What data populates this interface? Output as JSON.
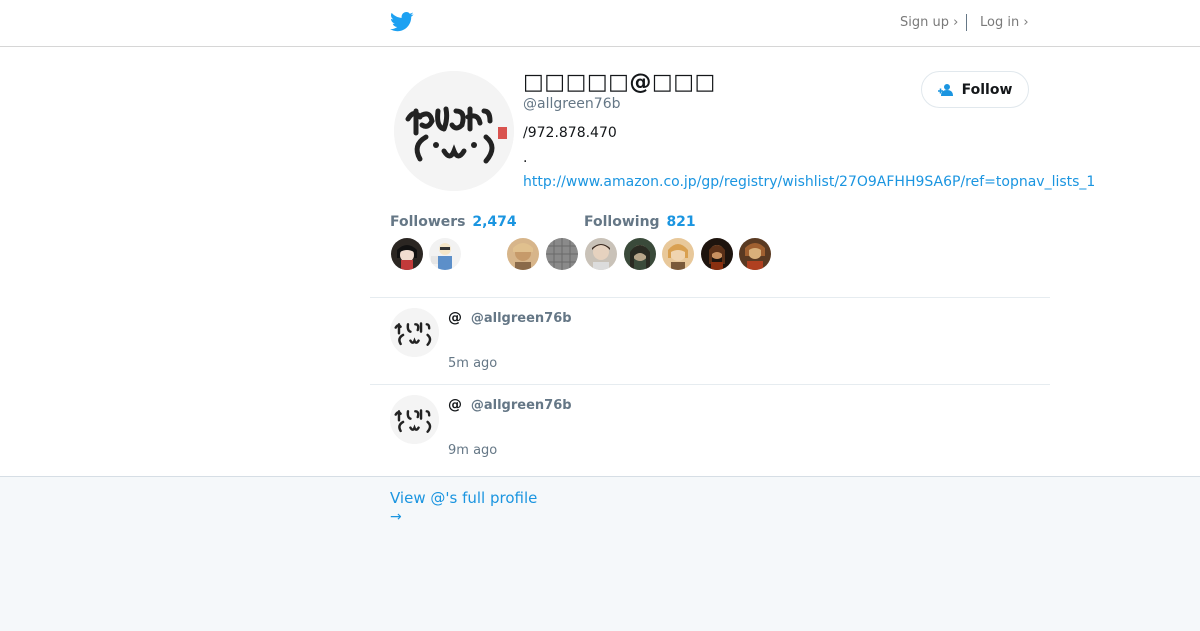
{
  "header": {
    "signup_label": "Sign up ›",
    "login_label": "Log in ›"
  },
  "profile": {
    "display_name": "□□□□□@□□□",
    "handle": "@allgreen76b",
    "bio_line1": "/972.878.470",
    "bio_line2": ".",
    "url": "http://www.amazon.co.jp/gp/registry/wishlist/27O9AFHH9SA6P/ref=topnav_lists_1",
    "follow_label": "Follow"
  },
  "stats": {
    "followers_label": "Followers",
    "followers_count": "2,474",
    "following_label": "Following",
    "following_count": "821"
  },
  "tweets": [
    {
      "name": "@",
      "handle": "@allgreen76b",
      "time": "5m ago"
    },
    {
      "name": "@",
      "handle": "@allgreen76b",
      "time": "9m ago"
    }
  ],
  "footer": {
    "view_profile_label": "View @'s full profile",
    "arrow": "→"
  },
  "colors": {
    "accent": "#1b95e0",
    "muted": "#657786",
    "footer_bg": "#f5f8fa",
    "twitter_blue": "#1da1f2"
  },
  "icons": [
    "twitter-bird-icon",
    "follow-person-icon",
    "arrow-right-icon"
  ]
}
